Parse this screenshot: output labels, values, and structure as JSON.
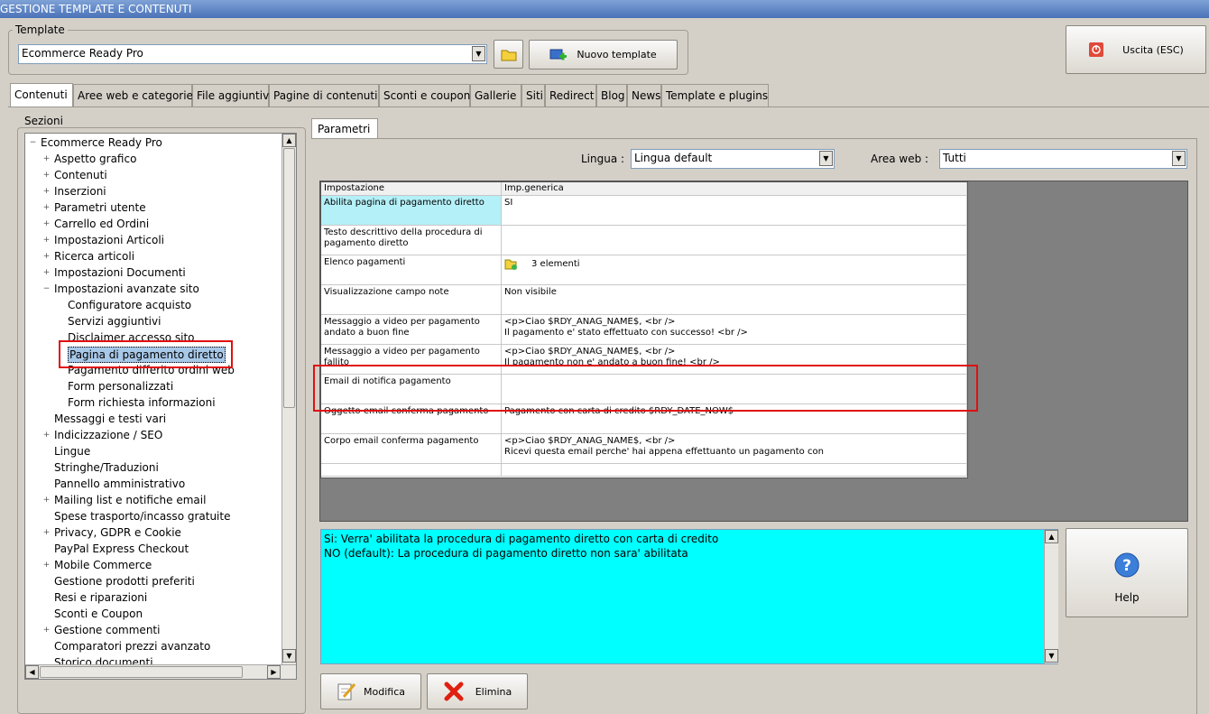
{
  "window": {
    "title": "GESTIONE TEMPLATE E CONTENUTI"
  },
  "template": {
    "legend": "Template",
    "selected": "Ecommerce Ready Pro",
    "new_button": "Nuovo template",
    "exit_button": "Uscita (ESC)"
  },
  "tabs": [
    "Contenuti",
    "Aree web e categorie",
    "File aggiuntivi",
    "Pagine di contenuti",
    "Sconti e coupon",
    "Gallerie",
    "Siti",
    "Redirect",
    "Blog",
    "News",
    "Template e plugins"
  ],
  "sidebar": {
    "legend": "Sezioni",
    "root": "Ecommerce Ready Pro",
    "items": [
      {
        "label": "Aspetto grafico",
        "level": 1,
        "expander": "+"
      },
      {
        "label": "Contenuti",
        "level": 1,
        "expander": "+"
      },
      {
        "label": "Inserzioni",
        "level": 1,
        "expander": "+"
      },
      {
        "label": "Parametri utente",
        "level": 1,
        "expander": "+"
      },
      {
        "label": "Carrello ed Ordini",
        "level": 1,
        "expander": "+"
      },
      {
        "label": "Impostazioni Articoli",
        "level": 1,
        "expander": "+"
      },
      {
        "label": "Ricerca articoli",
        "level": 1,
        "expander": "+"
      },
      {
        "label": "Impostazioni Documenti",
        "level": 1,
        "expander": "+"
      },
      {
        "label": "Impostazioni avanzate sito",
        "level": 1,
        "expander": "−"
      },
      {
        "label": "Configuratore acquisto",
        "level": 2,
        "expander": ""
      },
      {
        "label": "Servizi aggiuntivi",
        "level": 2,
        "expander": ""
      },
      {
        "label": "Disclaimer accesso sito",
        "level": 2,
        "expander": ""
      },
      {
        "label": "Pagina di pagamento diretto",
        "level": 2,
        "expander": "",
        "selected": true
      },
      {
        "label": "Pagamento differito ordini web",
        "level": 2,
        "expander": ""
      },
      {
        "label": "Form personalizzati",
        "level": 2,
        "expander": ""
      },
      {
        "label": "Form richiesta informazioni",
        "level": 2,
        "expander": ""
      },
      {
        "label": "Messaggi e testi vari",
        "level": 1,
        "expander": ""
      },
      {
        "label": "Indicizzazione / SEO",
        "level": 1,
        "expander": "+"
      },
      {
        "label": "Lingue",
        "level": 1,
        "expander": ""
      },
      {
        "label": "Stringhe/Traduzioni",
        "level": 1,
        "expander": ""
      },
      {
        "label": "Pannello amministrativo",
        "level": 1,
        "expander": ""
      },
      {
        "label": "Mailing list e notifiche email",
        "level": 1,
        "expander": "+"
      },
      {
        "label": "Spese trasporto/incasso gratuite",
        "level": 1,
        "expander": ""
      },
      {
        "label": "Privacy, GDPR e Cookie",
        "level": 1,
        "expander": "+"
      },
      {
        "label": "PayPal Express Checkout",
        "level": 1,
        "expander": ""
      },
      {
        "label": "Mobile Commerce",
        "level": 1,
        "expander": "+"
      },
      {
        "label": "Gestione prodotti preferiti",
        "level": 1,
        "expander": ""
      },
      {
        "label": "Resi e riparazioni",
        "level": 1,
        "expander": ""
      },
      {
        "label": "Sconti e Coupon",
        "level": 1,
        "expander": ""
      },
      {
        "label": "Gestione commenti",
        "level": 1,
        "expander": "+"
      },
      {
        "label": "Comparatori prezzi avanzato",
        "level": 1,
        "expander": ""
      },
      {
        "label": "Storico documenti",
        "level": 1,
        "expander": ""
      }
    ]
  },
  "params": {
    "tab_label": "Parametri",
    "lingua_label": "Lingua :",
    "lingua_value": "Lingua default",
    "area_label": "Area web :",
    "area_value": "Tutti",
    "columns": [
      "Impostazione",
      "Imp.generica"
    ],
    "rows": [
      {
        "name": "Abilita pagina di pagamento diretto",
        "value": "SI",
        "value2": ""
      },
      {
        "name": "Testo descrittivo della procedura di pagamento diretto",
        "value": "",
        "value2": ""
      },
      {
        "name": "Elenco pagamenti",
        "value": "3 elementi",
        "value2": ""
      },
      {
        "name": "Visualizzazione campo note",
        "value": "Non visibile",
        "value2": ""
      },
      {
        "name": "Messaggio a video per pagamento andato a buon fine",
        "value": "<p>Ciao $RDY_ANAG_NAME$, <br />",
        "value2": "Il pagamento e' stato effettuato con successo! <br />"
      },
      {
        "name": "Messaggio a video per pagamento fallito",
        "value": "<p>Ciao $RDY_ANAG_NAME$, <br />",
        "value2": "Il pagamento non e' andato a buon fine! <br />"
      },
      {
        "name": "Email di notifica pagamento",
        "value": "",
        "value2": ""
      },
      {
        "name": "Oggetto email conferma pagamento",
        "value": "Pagamento con carta di credito $RDY_DATE_NOW$",
        "value2": ""
      },
      {
        "name": "Corpo email conferma pagamento",
        "value": "<p>Ciao $RDY_ANAG_NAME$, <br />",
        "value2": "Ricevi questa email perche' hai appena effettuanto un pagamento con"
      }
    ],
    "help_text_1": "Si: Verra' abilitata la procedura di pagamento diretto con carta di credito",
    "help_text_2": "NO (default): La procedura di pagamento diretto non sara' abilitata",
    "help_button": "Help",
    "modifica_button": "Modifica",
    "elimina_button": "Elimina"
  },
  "colors": {
    "highlight_cell": "#b4f0f8",
    "help_bg": "#00ffff",
    "annotation": "#e01010",
    "grid_bg": "#808080"
  }
}
